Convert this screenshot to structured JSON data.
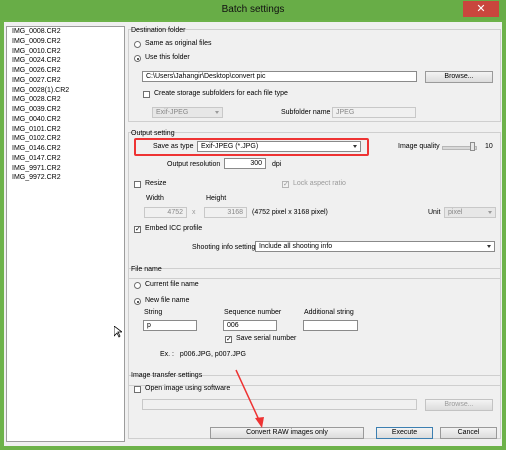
{
  "window": {
    "title": "Batch settings",
    "close": "✕"
  },
  "files": [
    "IMG_0008.CR2",
    "IMG_0009.CR2",
    "IMG_0010.CR2",
    "IMG_0024.CR2",
    "IMG_0026.CR2",
    "IMG_0027.CR2",
    "IMG_0028(1).CR2",
    "IMG_0028.CR2",
    "IMG_0039.CR2",
    "IMG_0040.CR2",
    "IMG_0101.CR2",
    "IMG_0102.CR2",
    "IMG_0146.CR2",
    "IMG_0147.CR2",
    "IMG_9971.CR2",
    "IMG_9972.CR2"
  ],
  "destination": {
    "label": "Destination folder",
    "same_as_original": "Same as original files",
    "use_this_folder": "Use this folder",
    "path": "C:\\Users\\Jahangir\\Desktop\\convert pic",
    "browse": "Browse...",
    "create_subfolders": "Create storage subfolders for each file type",
    "file_type": "Exif-JPEG",
    "subfolder_name_label": "Subfolder name",
    "subfolder_name_value": "JPEG"
  },
  "output": {
    "label": "Output setting",
    "save_as_type_label": "Save as type",
    "save_as_type_value": "Exif-JPEG (*.JPG)",
    "image_quality_label": "Image quality",
    "image_quality_value": "10",
    "resolution_label": "Output resolution",
    "resolution_value": "300",
    "resolution_unit": "dpi",
    "resize_label": "Resize",
    "lock_aspect": "Lock aspect ratio",
    "width_label": "Width",
    "height_label": "Height",
    "width_value": "4752",
    "times": "x",
    "height_value": "3168",
    "pixel_info": "(4752 pixel x 3168 pixel)",
    "unit_label": "Unit",
    "unit_value": "pixel",
    "embed_icc": "Embed ICC profile",
    "shooting_info_label": "Shooting info setting",
    "shooting_info_value": "Include all shooting info"
  },
  "filename": {
    "label": "File name",
    "current": "Current file name",
    "new": "New file name",
    "string_label": "String",
    "string_value": "p",
    "seq_label": "Sequence number",
    "seq_value": "006",
    "additional_label": "Additional string",
    "additional_value": "",
    "save_serial": "Save serial number",
    "example": "Ex. :   p006.JPG, p007.JPG"
  },
  "transfer": {
    "label": "Image transfer settings",
    "open_with": "Open image using software",
    "software_value": "",
    "browse": "Browse..."
  },
  "buttons": {
    "convert_raw": "Convert RAW images only",
    "execute": "Execute",
    "cancel": "Cancel"
  },
  "colors": {
    "titlebar": "#68ad47",
    "close": "#c9463d",
    "highlight": "#ee3333",
    "annotation_arrow": "#ee3333"
  }
}
